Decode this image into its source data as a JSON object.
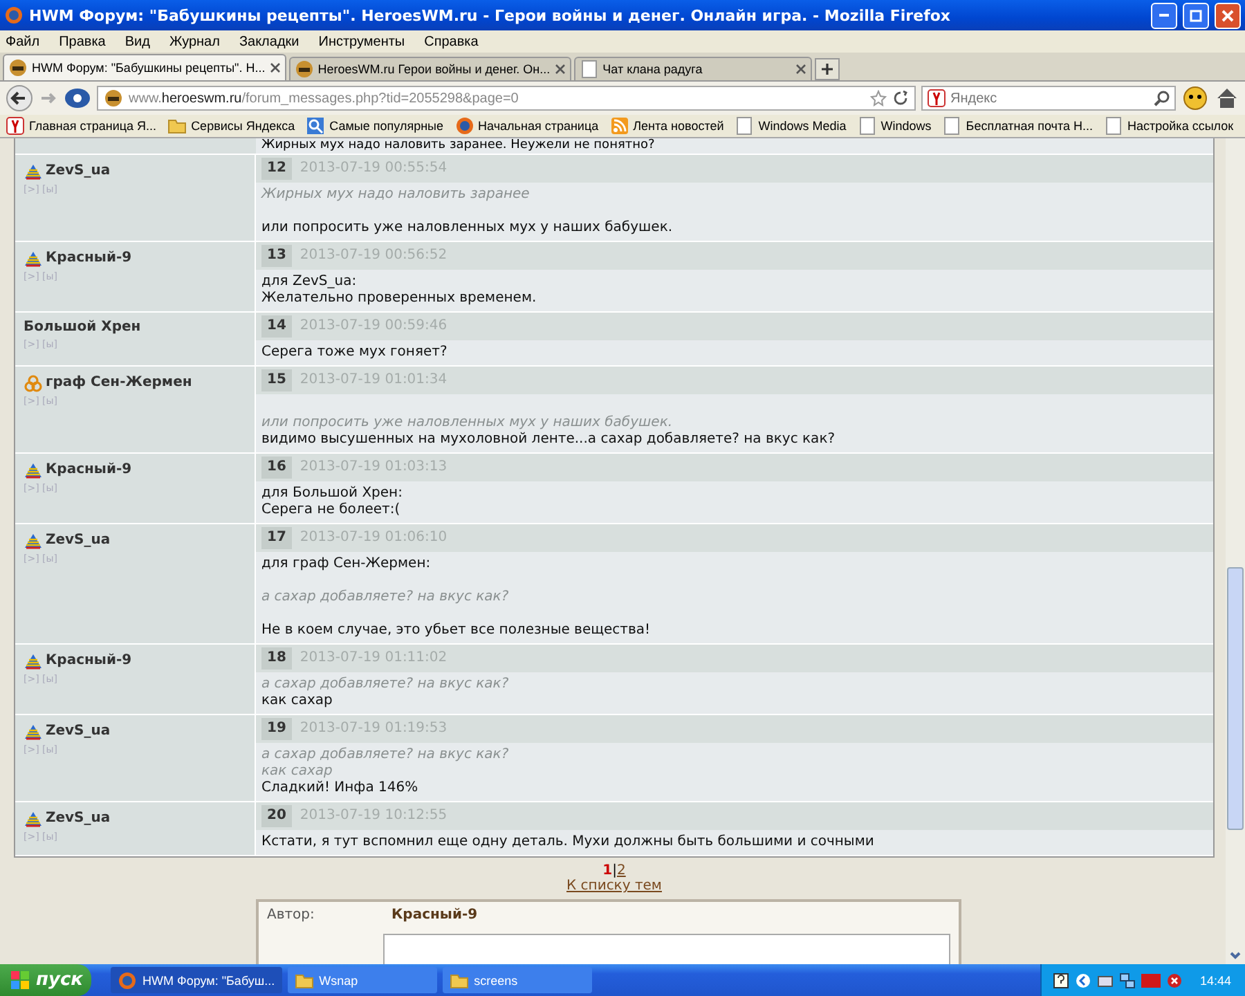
{
  "window": {
    "title": "HWM Форум: \"Бабушкины рецепты\". HeroesWM.ru - Герои войны и денег. Онлайн игра. - Mozilla Firefox"
  },
  "menu": [
    "Файл",
    "Правка",
    "Вид",
    "Журнал",
    "Закладки",
    "Инструменты",
    "Справка"
  ],
  "tabs": [
    {
      "label": "HWM Форум: \"Бабушкины рецепты\". Н...",
      "selected": true
    },
    {
      "label": "HeroesWM.ru Герои войны и денег. Он...",
      "selected": false
    },
    {
      "label": "Чат клана радуга",
      "selected": false
    }
  ],
  "address": "www.**heroeswm.ru**/forum_messages.php?tid=2055298&page=0",
  "search": {
    "placeholder": "Яндекс"
  },
  "bookmarks": [
    {
      "label": "Главная страница Я...",
      "kind": "yandex"
    },
    {
      "label": "Сервисы Яндекса",
      "kind": "folder"
    },
    {
      "label": "Самые популярные",
      "kind": "search"
    },
    {
      "label": "Начальная страница",
      "kind": "firefox"
    },
    {
      "label": "Лента новостей",
      "kind": "feed"
    },
    {
      "label": "Windows Media",
      "kind": "page"
    },
    {
      "label": "Windows",
      "kind": "page"
    },
    {
      "label": "Бесплатная почта Н...",
      "kind": "page"
    },
    {
      "label": "Настройка ссылок",
      "kind": "page"
    }
  ],
  "cut_line": "Жирных мух надо наловить заранее. Неужели не понятно?",
  "posts": [
    {
      "author": "ZevS_ua",
      "kind": "clan",
      "links": "[>] [ы]",
      "number": "12",
      "date": "2013-07-19 00:55:54",
      "lines": [
        {
          "kind": "quote",
          "text": "Жирных мух надо наловить заранее"
        },
        {
          "kind": "blank"
        },
        {
          "kind": "text",
          "text": "или попросить уже наловленных мух у наших бабушек."
        }
      ]
    },
    {
      "author": "Красный-9",
      "kind": "clan",
      "links": "[>] [ы]",
      "number": "13",
      "date": "2013-07-19 00:56:52",
      "lines": [
        {
          "kind": "text",
          "text": "для ZevS_ua:"
        },
        {
          "kind": "text",
          "text": "Желательно проверенных временем."
        }
      ]
    },
    {
      "author": "Большой Хрен",
      "kind": "plain",
      "links": "[>] [ы]",
      "number": "14",
      "date": "2013-07-19 00:59:46",
      "lines": [
        {
          "kind": "text",
          "text": "Серега тоже мух гоняет?"
        }
      ]
    },
    {
      "author": "граф Сен-Жермен",
      "kind": "guild",
      "links": "[>] [ы]",
      "number": "15",
      "date": "2013-07-19 01:01:34",
      "lines": [
        {
          "kind": "blank"
        },
        {
          "kind": "quote",
          "text": "или попросить уже наловленных мух у наших бабушек."
        },
        {
          "kind": "text",
          "text": "видимо высушенных на мухоловной ленте...а сахар добавляете? на вкус как?"
        }
      ]
    },
    {
      "author": "Красный-9",
      "kind": "clan",
      "links": "[>] [ы]",
      "number": "16",
      "date": "2013-07-19 01:03:13",
      "lines": [
        {
          "kind": "text",
          "text": "для Большой Хрен:"
        },
        {
          "kind": "text",
          "text": "Серега не болеет:("
        }
      ]
    },
    {
      "author": "ZevS_ua",
      "kind": "clan",
      "links": "[>] [ы]",
      "number": "17",
      "date": "2013-07-19 01:06:10",
      "lines": [
        {
          "kind": "text",
          "text": "для граф Сен-Жермен:"
        },
        {
          "kind": "blank"
        },
        {
          "kind": "quote",
          "text": "а сахар добавляете? на вкус как?"
        },
        {
          "kind": "blank"
        },
        {
          "kind": "text",
          "text": "Не в коем случае, это убьет все полезные вещества!"
        }
      ]
    },
    {
      "author": "Красный-9",
      "kind": "clan",
      "links": "[>] [ы]",
      "number": "18",
      "date": "2013-07-19 01:11:02",
      "lines": [
        {
          "kind": "quote",
          "text": "а сахар добавляете? на вкус как?"
        },
        {
          "kind": "text",
          "text": "как сахар"
        }
      ]
    },
    {
      "author": "ZevS_ua",
      "kind": "clan",
      "links": "[>] [ы]",
      "number": "19",
      "date": "2013-07-19 01:19:53",
      "lines": [
        {
          "kind": "quote",
          "text": "а сахар добавляете? на вкус как?"
        },
        {
          "kind": "quote",
          "text": "как сахар"
        },
        {
          "kind": "text",
          "text": "Сладкий! Инфа 146%"
        }
      ]
    },
    {
      "author": "ZevS_ua",
      "kind": "clan",
      "links": "[>] [ы]",
      "number": "20",
      "date": "2013-07-19 10:12:55",
      "lines": [
        {
          "kind": "text",
          "text": "Кстати, я тут вспомнил еще одну деталь. Мухи должны быть большими и сочными"
        }
      ]
    }
  ],
  "pages": [
    {
      "label": "1",
      "selected": true
    },
    {
      "label": "2",
      "selected": false
    }
  ],
  "pages_separator": "|",
  "topic_list_link": "К списку тем",
  "reply_form": {
    "author_label": "Автор:",
    "author": "Красный-9"
  },
  "taskbar": {
    "start": "пуск",
    "items": [
      {
        "label": "HWM Форум: \"Бабуш...",
        "kind": "firefox",
        "selected": true
      },
      {
        "label": "Wsnap",
        "kind": "folder",
        "selected": false
      },
      {
        "label": "screens",
        "kind": "folder",
        "selected": false
      }
    ],
    "clock": "14:44"
  }
}
